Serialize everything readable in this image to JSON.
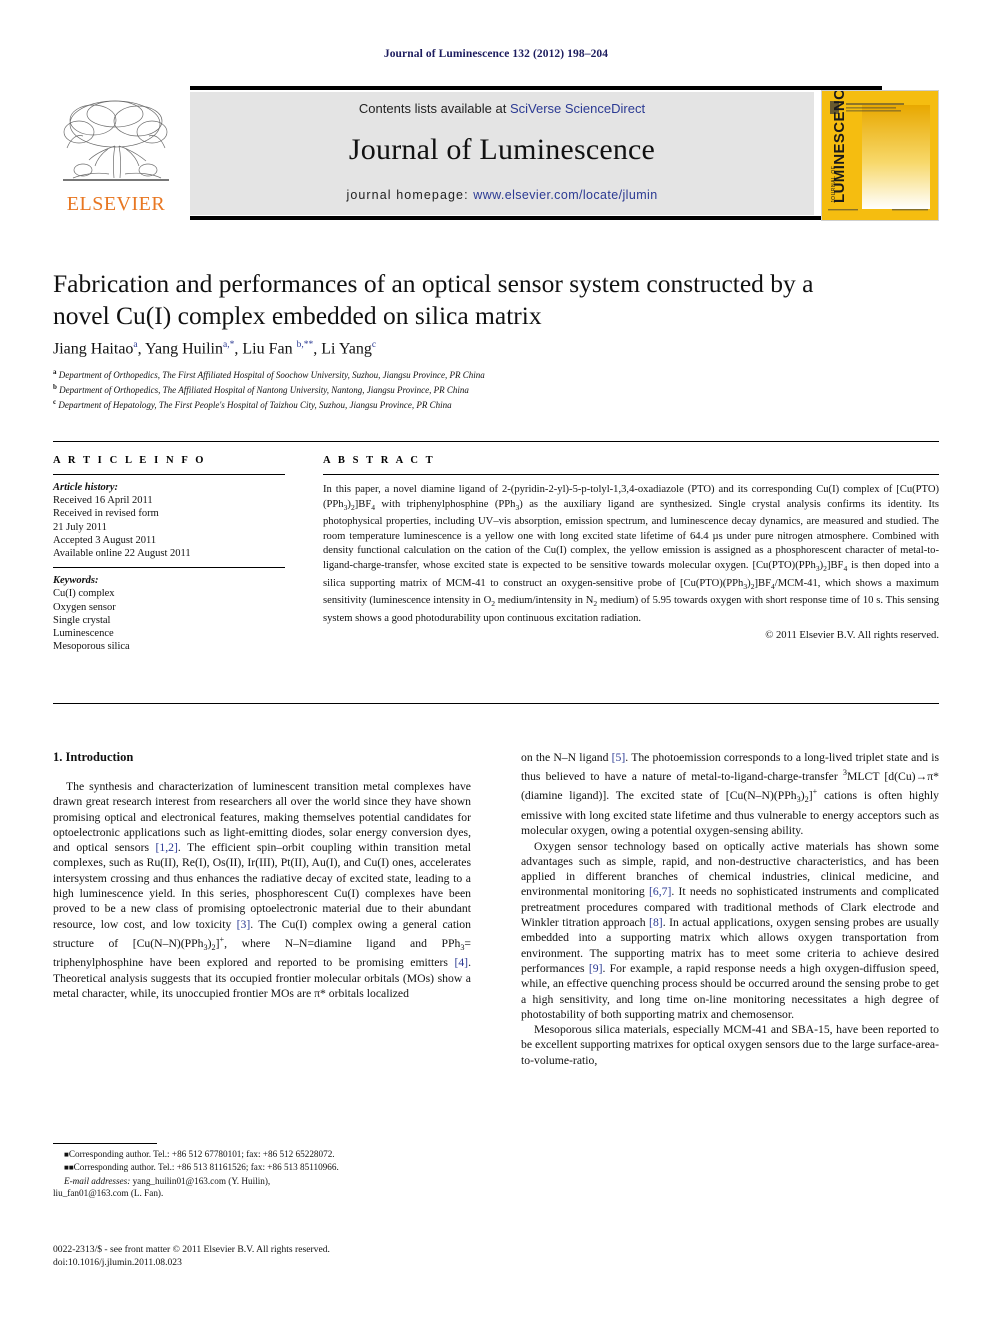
{
  "running_head": "Journal of Luminescence 132 (2012) 198–204",
  "masthead": {
    "contents_prefix": "Contents lists available at ",
    "contents_link": "SciVerse ScienceDirect",
    "journal_title": "Journal of Luminescence",
    "homepage_prefix": "journal homepage: ",
    "homepage_url": "www.elsevier.com/locate/jlumin",
    "publisher_wordmark": "ELSEVIER",
    "cover_title": "JOURNAL OF LUMINESCENCE",
    "accent_orange": "#e87722",
    "link_blue": "#2b3a93",
    "band_grey": "#e4e4e4",
    "cover_yellow": "#f5bd10"
  },
  "article": {
    "title": "Fabrication and performances of an optical sensor system constructed by a novel Cu(I) complex embedded on silica matrix",
    "authors_html": "Jiang Haitao<sup>a</sup>, Yang Huilin<sup>a,*</sup>, Liu Fan <sup>b,**</sup>, Li Yang<sup>c</sup>",
    "affiliations": [
      {
        "marker": "a",
        "text": "Department of Orthopedics, The First Affiliated Hospital of Soochow University, Suzhou, Jiangsu Province, PR China"
      },
      {
        "marker": "b",
        "text": "Department of Orthopedics, The Affiliated Hospital of Nantong University, Nantong, Jiangsu Province, PR China"
      },
      {
        "marker": "c",
        "text": "Department of Hepatology, The First People's Hospital of Taizhou City, Suzhou, Jiangsu Province, PR China"
      }
    ]
  },
  "info": {
    "heading": "A R T I C L E   I N F O",
    "history_label": "Article history:",
    "history": [
      "Received 16 April 2011",
      "Received in revised form",
      "21 July 2011",
      "Accepted 3 August 2011",
      "Available online 22 August 2011"
    ],
    "keywords_label": "Keywords:",
    "keywords": [
      "Cu(I) complex",
      "Oxygen sensor",
      "Single crystal",
      "Luminescence",
      "Mesoporous silica"
    ]
  },
  "abstract": {
    "heading": "A B S T R A C T",
    "body_html": "In this paper, a novel diamine ligand of 2-(pyridin-2-yl)-5-p-tolyl-1,3,4-oxadiazole (PTO) and its corresponding Cu(I) complex of [Cu(PTO)(PPh<sub>3</sub>)<sub>2</sub>]BF<sub>4</sub> with triphenylphosphine (PPh<sub>3</sub>) as the auxiliary ligand are synthesized. Single crystal analysis confirms its identity. Its photophysical properties, including UV–vis absorption, emission spectrum, and luminescence decay dynamics, are measured and studied. The room temperature luminescence is a yellow one with long excited state lifetime of 64.4 &micro;s under pure nitrogen atmosphere. Combined with density functional calculation on the cation of the Cu(I) complex, the yellow emission is assigned as a phosphorescent character of metal-to-ligand-charge-transfer, whose excited state is expected to be sensitive towards molecular oxygen. [Cu(PTO)(PPh<sub>3</sub>)<sub>2</sub>]BF<sub>4</sub> is then doped into a silica supporting matrix of MCM-41 to construct an oxygen-sensitive probe of [Cu(PTO)(PPh<sub>3</sub>)<sub>2</sub>]BF<sub>4</sub>/MCM-41, which shows a maximum sensitivity (luminescence intensity in O<sub>2</sub> medium/intensity in N<sub>2</sub> medium) of 5.95 towards oxygen with short response time of 10 s. This sensing system shows a good photodurability upon continuous excitation radiation.",
    "copyright": "© 2011 Elsevier B.V. All rights reserved."
  },
  "body": {
    "section_number_title": "1. Introduction",
    "left_paragraphs_html": [
      "The synthesis and characterization of luminescent transition metal complexes have drawn great research interest from researchers all over the world since they have shown promising optical and electronical features, making themselves potential candidates for optoelectronic applications such as light-emitting diodes, solar energy conversion dyes, and optical sensors <span class=\"ref\">[1,2]</span>. The efficient spin–orbit coupling within transition metal complexes, such as Ru(II), Re(I), Os(II), Ir(III), Pt(II), Au(I), and Cu(I) ones, accelerates intersystem crossing and thus enhances the radiative decay of excited state, leading to a high luminescence yield. In this series, phosphorescent Cu(I) complexes have been proved to be a new class of promising optoelectronic material due to their abundant resource, low cost, and low toxicity <span class=\"ref\">[3]</span>. The Cu(I) complex owing a general cation structure of [Cu(N–N)(PPh<sub>3</sub>)<sub>2</sub>]<sup>+</sup>, where N–N=diamine ligand and PPh<sub>3</sub>= triphenylphosphine have been explored and reported to be promising emitters <span class=\"ref\">[4]</span>. Theoretical analysis suggests that its occupied frontier molecular orbitals (MOs) show a metal character, while, its unoccupied frontier MOs are &pi;* orbitals localized"
    ],
    "right_paragraphs_html": [
      "on the N–N ligand <span class=\"ref\">[5]</span>. The photoemission corresponds to a long-lived triplet state and is thus believed to have a nature of metal-to-ligand-charge-transfer <sup>3</sup>MLCT [d(Cu)→&pi;*(diamine ligand)]. The excited state of [Cu(N–N)(PPh<sub>3</sub>)<sub>2</sub>]<sup>+</sup> cations is often highly emissive with long excited state lifetime and thus vulnerable to energy acceptors such as molecular oxygen, owing a potential oxygen-sensing ability.",
      "Oxygen sensor technology based on optically active materials has shown some advantages such as simple, rapid, and non-destructive characteristics, and has been applied in different branches of chemical industries, clinical medicine, and environmental monitoring <span class=\"ref\">[6,7]</span>. It needs no sophisticated instruments and complicated pretreatment procedures compared with traditional methods of Clark electrode and Winkler titration approach <span class=\"ref\">[8]</span>. In actual applications, oxygen sensing probes are usually embedded into a supporting matrix which allows oxygen transportation from environment. The supporting matrix has to meet some criteria to achieve desired performances <span class=\"ref\">[9]</span>. For example, a rapid response needs a high oxygen-diffusion speed, while, an effective quenching process should be occurred around the sensing probe to get a high sensitivity, and long time on-line monitoring necessitates a high degree of photostability of both supporting matrix and chemosensor.",
      "Mesoporous silica materials, especially MCM-41 and SBA-15, have been reported to be excellent supporting matrixes for optical oxygen sensors due to the large surface-area-to-volume-ratio,"
    ]
  },
  "footnotes": {
    "line1_html": "<span class=\"star\">&#9632;</span>Corresponding author. Tel.: +86 512 67780101; fax: +86 512 65228072.",
    "line2_html": "<span class=\"star\">&#9632;&#9632;</span>Corresponding author. Tel.: +86 513 81161526; fax: +86 513 85110966.",
    "email_label": "E-mail addresses:",
    "email_line1": " yang_huilin01@163.com (Y. Huilin),",
    "email_line2": "liu_fan01@163.com (L. Fan)."
  },
  "imprint": {
    "line1": "0022-2313/$ - see front matter © 2011 Elsevier B.V. All rights reserved.",
    "line2": "doi:10.1016/j.jlumin.2011.08.023"
  }
}
